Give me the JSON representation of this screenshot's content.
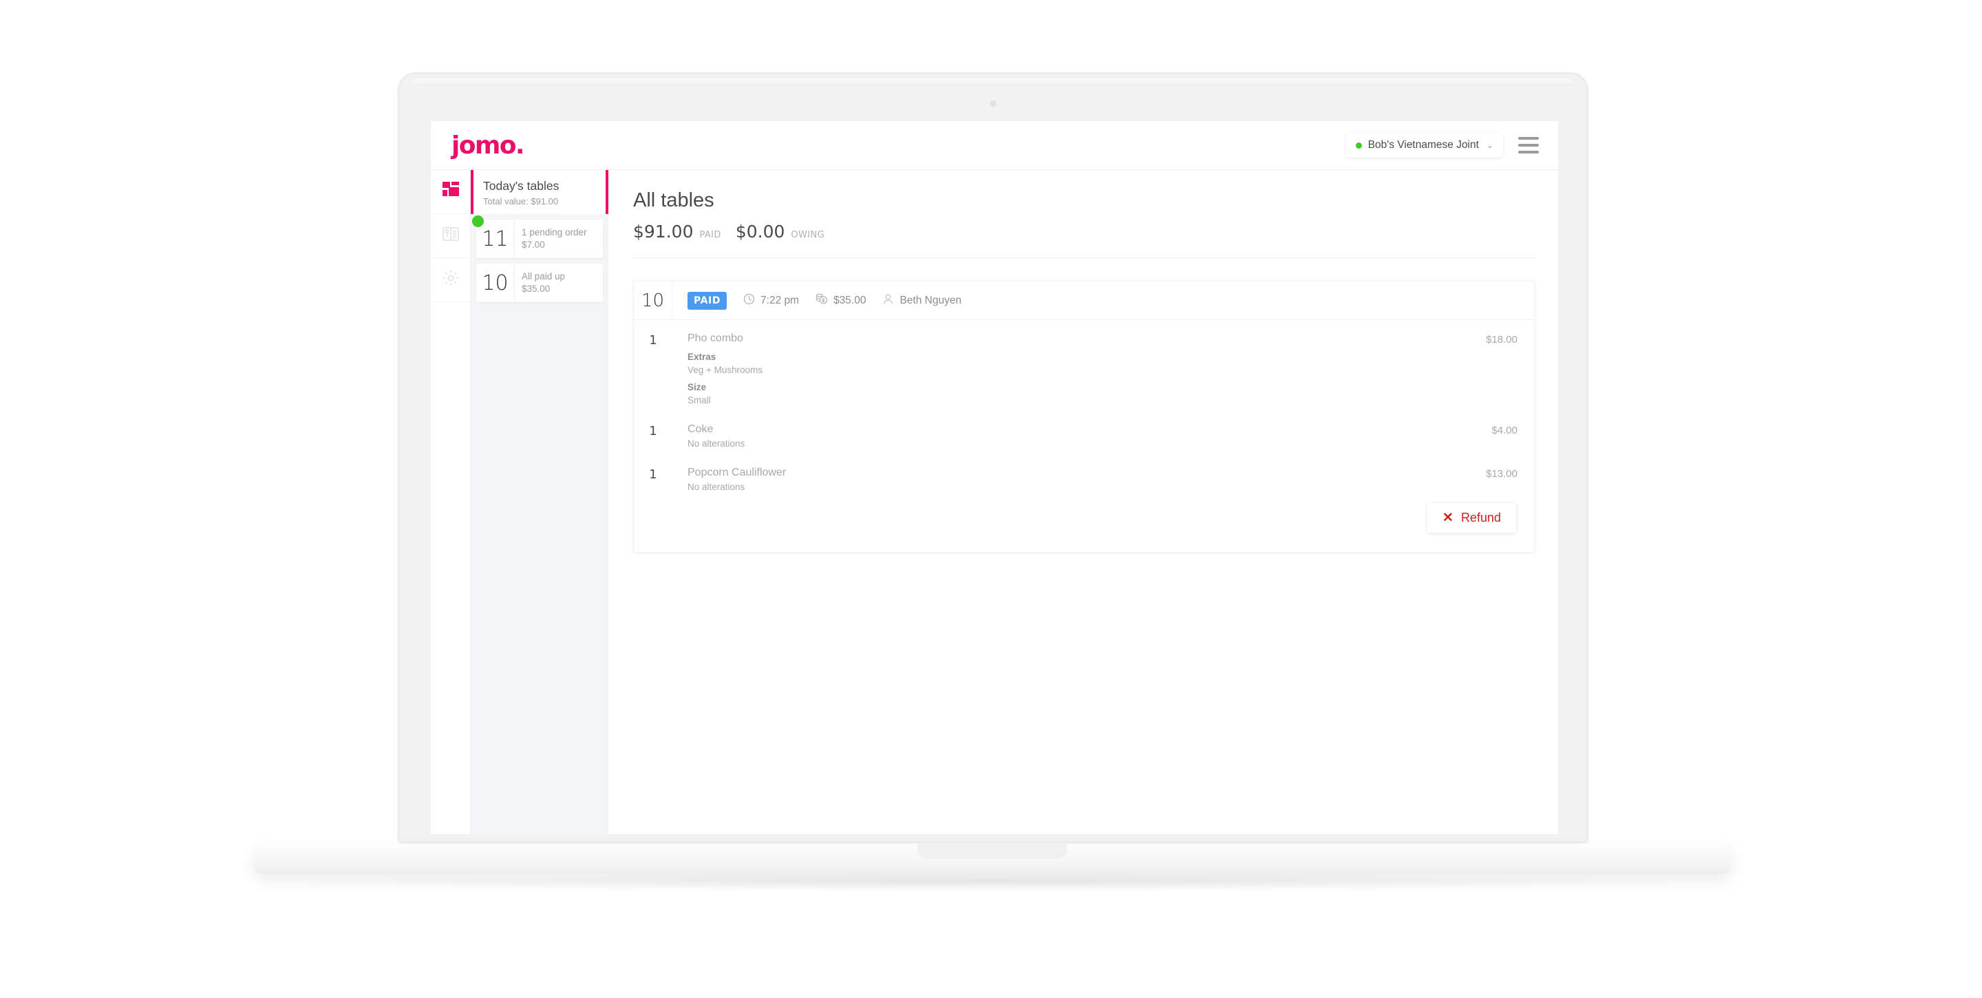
{
  "topbar": {
    "logo": "jomo.",
    "venue_name": "Bob's Vietnamese Joint",
    "venue_caret": "⌄",
    "venue_status_color": "#3fcc26",
    "menu_icon": "hamburger-menu-icon"
  },
  "rail": {
    "items": [
      {
        "icon": "dashboard-grid-icon",
        "active": true,
        "color": "#ec0f69"
      },
      {
        "icon": "menu-book-icon",
        "active": false,
        "color": "#e2e2e2"
      },
      {
        "icon": "settings-gear-icon",
        "active": false,
        "color": "#e2e2e2"
      }
    ]
  },
  "tables_panel": {
    "title": "Today's tables",
    "subtitle": "Total value: $91.00",
    "accent_color": "#ec0f69",
    "tables": [
      {
        "number": "11",
        "status_line": "1 pending order",
        "amount": "$7.00",
        "has_pending_dot": true
      },
      {
        "number": "10",
        "status_line": "All paid up",
        "amount": "$35.00",
        "has_pending_dot": false
      }
    ]
  },
  "main": {
    "title": "All tables",
    "paid_amount": "$91.00",
    "paid_label": "PAID",
    "owing_amount": "$0.00",
    "owing_label": "OWING"
  },
  "order": {
    "table_number": "10",
    "status_badge": "PAID",
    "status_badge_color": "#4a9bef",
    "time": "7:22 pm",
    "total": "$35.00",
    "customer": "Beth Nguyen",
    "clock_icon": "clock-icon",
    "money_icon": "coins-money-icon",
    "person_icon": "person-icon",
    "items": [
      {
        "qty": "1",
        "name": "Pho combo",
        "price": "$18.00",
        "options": [
          {
            "label": "Extras",
            "value": "Veg + Mushrooms"
          },
          {
            "label": "Size",
            "value": "Small"
          }
        ],
        "note": ""
      },
      {
        "qty": "1",
        "name": "Coke",
        "price": "$4.00",
        "options": [],
        "note": "No alterations"
      },
      {
        "qty": "1",
        "name": "Popcorn Cauliflower",
        "price": "$13.00",
        "options": [],
        "note": "No alterations"
      }
    ],
    "refund_label": "Refund",
    "refund_icon": "close-x-icon",
    "refund_color": "#cc2020"
  }
}
